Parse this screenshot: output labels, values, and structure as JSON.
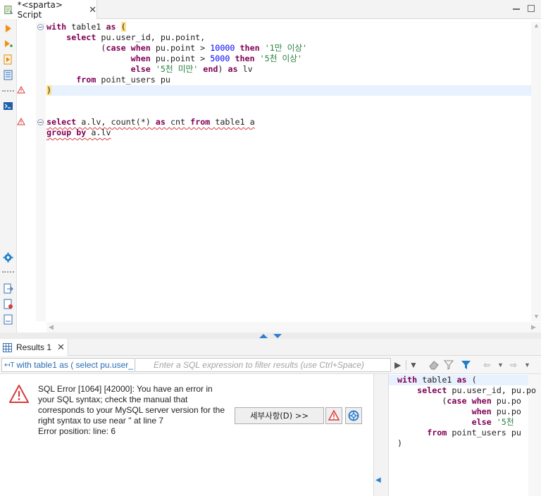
{
  "editor_tab": {
    "title": "*<sparta> Script",
    "close": "✕"
  },
  "window_controls": {
    "minimize": "minimize",
    "maximize": "maximize"
  },
  "code": {
    "lines": [
      [
        {
          "t": "with",
          "c": "kw"
        },
        {
          "t": " table1 "
        },
        {
          "t": "as",
          "c": "kw"
        },
        {
          "t": " "
        },
        {
          "t": "(",
          "c": "hl-paren"
        }
      ],
      [
        {
          "t": "    "
        },
        {
          "t": "select",
          "c": "kw"
        },
        {
          "t": " pu.user_id, pu.point,"
        }
      ],
      [
        {
          "t": "           ("
        },
        {
          "t": "case",
          "c": "kw"
        },
        {
          "t": " "
        },
        {
          "t": "when",
          "c": "kw"
        },
        {
          "t": " pu.point > "
        },
        {
          "t": "10000",
          "c": "num"
        },
        {
          "t": " "
        },
        {
          "t": "then",
          "c": "kw"
        },
        {
          "t": " "
        },
        {
          "t": "'1만 이상'",
          "c": "str"
        }
      ],
      [
        {
          "t": "                 "
        },
        {
          "t": "when",
          "c": "kw"
        },
        {
          "t": " pu.point > "
        },
        {
          "t": "5000",
          "c": "num"
        },
        {
          "t": " "
        },
        {
          "t": "then",
          "c": "kw"
        },
        {
          "t": " "
        },
        {
          "t": "'5천 이상'",
          "c": "str"
        }
      ],
      [
        {
          "t": "                 "
        },
        {
          "t": "else",
          "c": "kw"
        },
        {
          "t": " "
        },
        {
          "t": "'5천 미만'",
          "c": "str"
        },
        {
          "t": " "
        },
        {
          "t": "end",
          "c": "kw"
        },
        {
          "t": ") "
        },
        {
          "t": "as",
          "c": "kw"
        },
        {
          "t": " lv"
        }
      ],
      [
        {
          "t": "      "
        },
        {
          "t": "from",
          "c": "kw"
        },
        {
          "t": " point_users pu"
        }
      ],
      [
        {
          "t": ")",
          "c": "hl-paren"
        }
      ],
      [],
      [],
      [
        {
          "t": "select a.lv, count(*) as cnt from table1 a",
          "c": "squig-mixed"
        }
      ],
      [
        {
          "t": "group by a.lv",
          "c": "squig-mixed2"
        }
      ]
    ]
  },
  "results_tab": {
    "title": "Results 1",
    "close": "✕"
  },
  "filter": {
    "query_text": "with table1 as ( select pu.user_",
    "placeholder": "Enter a SQL expression to filter results (use Ctrl+Space)"
  },
  "error": {
    "lines": [
      "SQL Error [1064] [42000]: You have an error in",
      "your SQL syntax; check the manual that",
      "corresponds to your MySQL server version for the",
      "right syntax to use near '' at line 7",
      "Error position: line: 6"
    ],
    "details_button": "세부사항(D) >>"
  },
  "preview": {
    "lines": [
      [
        {
          "t": "with",
          "c": "kw"
        },
        {
          "t": " table1 "
        },
        {
          "t": "as",
          "c": "kw"
        },
        {
          "t": " ("
        }
      ],
      [
        {
          "t": "    "
        },
        {
          "t": "select",
          "c": "kw"
        },
        {
          "t": " pu.user_id, pu.po"
        }
      ],
      [
        {
          "t": "         ("
        },
        {
          "t": "case",
          "c": "kw"
        },
        {
          "t": " "
        },
        {
          "t": "when",
          "c": "kw"
        },
        {
          "t": " pu.po"
        }
      ],
      [
        {
          "t": "               "
        },
        {
          "t": "when",
          "c": "kw"
        },
        {
          "t": " pu.po"
        }
      ],
      [
        {
          "t": "               "
        },
        {
          "t": "else",
          "c": "kw"
        },
        {
          "t": " "
        },
        {
          "t": "'5천",
          "c": "str"
        }
      ],
      [
        {
          "t": "      "
        },
        {
          "t": "from",
          "c": "kw"
        },
        {
          "t": " point_users pu"
        }
      ],
      [
        {
          "t": ")"
        }
      ]
    ]
  },
  "colors": {
    "keyword": "#7f0055",
    "number": "#0000ff",
    "string": "#2a7f3f",
    "error": "#d93a3a",
    "current_line": "#e8f2fe"
  }
}
